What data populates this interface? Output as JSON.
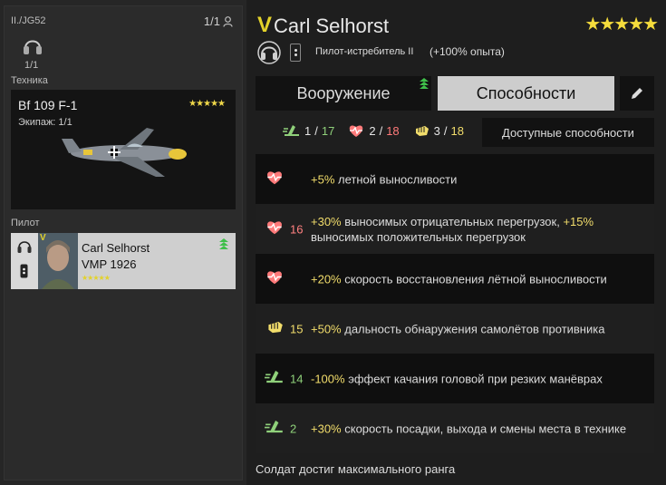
{
  "left": {
    "unit": "II./JG52",
    "slots": "1/1",
    "crew_count": "1/1",
    "section_plane": "Техника",
    "plane": {
      "name": "Bf 109 F-1",
      "crew": "Экипаж: 1/1",
      "stars": "★★★★★"
    },
    "section_pilot": "Пилот",
    "pilot": {
      "rank": "V",
      "name": "Carl Selhorst",
      "vmp": "VMP 1926",
      "stars": "★★★★★"
    }
  },
  "header": {
    "rank": "V",
    "name": "Carl Selhorst",
    "stars": "★★★★★",
    "spec": "Пилот-истребитель II",
    "exp": "(+100% опыта)"
  },
  "tabs": {
    "weapons": "Вооружение",
    "skills": "Способности"
  },
  "counters": [
    {
      "icon": "stamina-icon",
      "current": "1",
      "max": "17",
      "cls": "c-max-green"
    },
    {
      "icon": "heart-icon",
      "current": "2",
      "max": "18",
      "cls": "c-max-pink"
    },
    {
      "icon": "fist-icon",
      "current": "3",
      "max": "18",
      "cls": "c-max-yellow"
    }
  ],
  "available_button": "Доступные способности",
  "skills": [
    {
      "icon": "heart-icon",
      "num": "",
      "prefix": "+5%",
      "text": " летной выносливости",
      "prefix2": "",
      "text2": ""
    },
    {
      "icon": "heart-icon",
      "num": "16",
      "prefix": "+30%",
      "text": " выносимых отрицательных перегрузок, ",
      "prefix2": "+15%",
      "text2": " выносимых положительных перегрузок"
    },
    {
      "icon": "heart-icon",
      "num": "",
      "prefix": "+20%",
      "text": " скорость восстановления лётной выносливости",
      "prefix2": "",
      "text2": ""
    },
    {
      "icon": "fist-icon",
      "num": "15",
      "prefix": "+50%",
      "text": " дальность обнаружения самолётов противника",
      "prefix2": "",
      "text2": ""
    },
    {
      "icon": "stamina-icon",
      "num": "14",
      "prefix": "-100%",
      "text": " эффект качания головой при резких манёврах",
      "prefix2": "",
      "text2": ""
    },
    {
      "icon": "stamina-icon",
      "num": "2",
      "prefix": "+30%",
      "text": " скорость посадки, выхода и смены места в технике",
      "prefix2": "",
      "text2": ""
    }
  ],
  "footer": "Солдат достиг максимального ранга",
  "colors": {
    "accent_yellow": "#e3d22a",
    "pink": "#ff7a7a",
    "green": "#8fd07a",
    "badge_green": "#3fbf4a"
  }
}
